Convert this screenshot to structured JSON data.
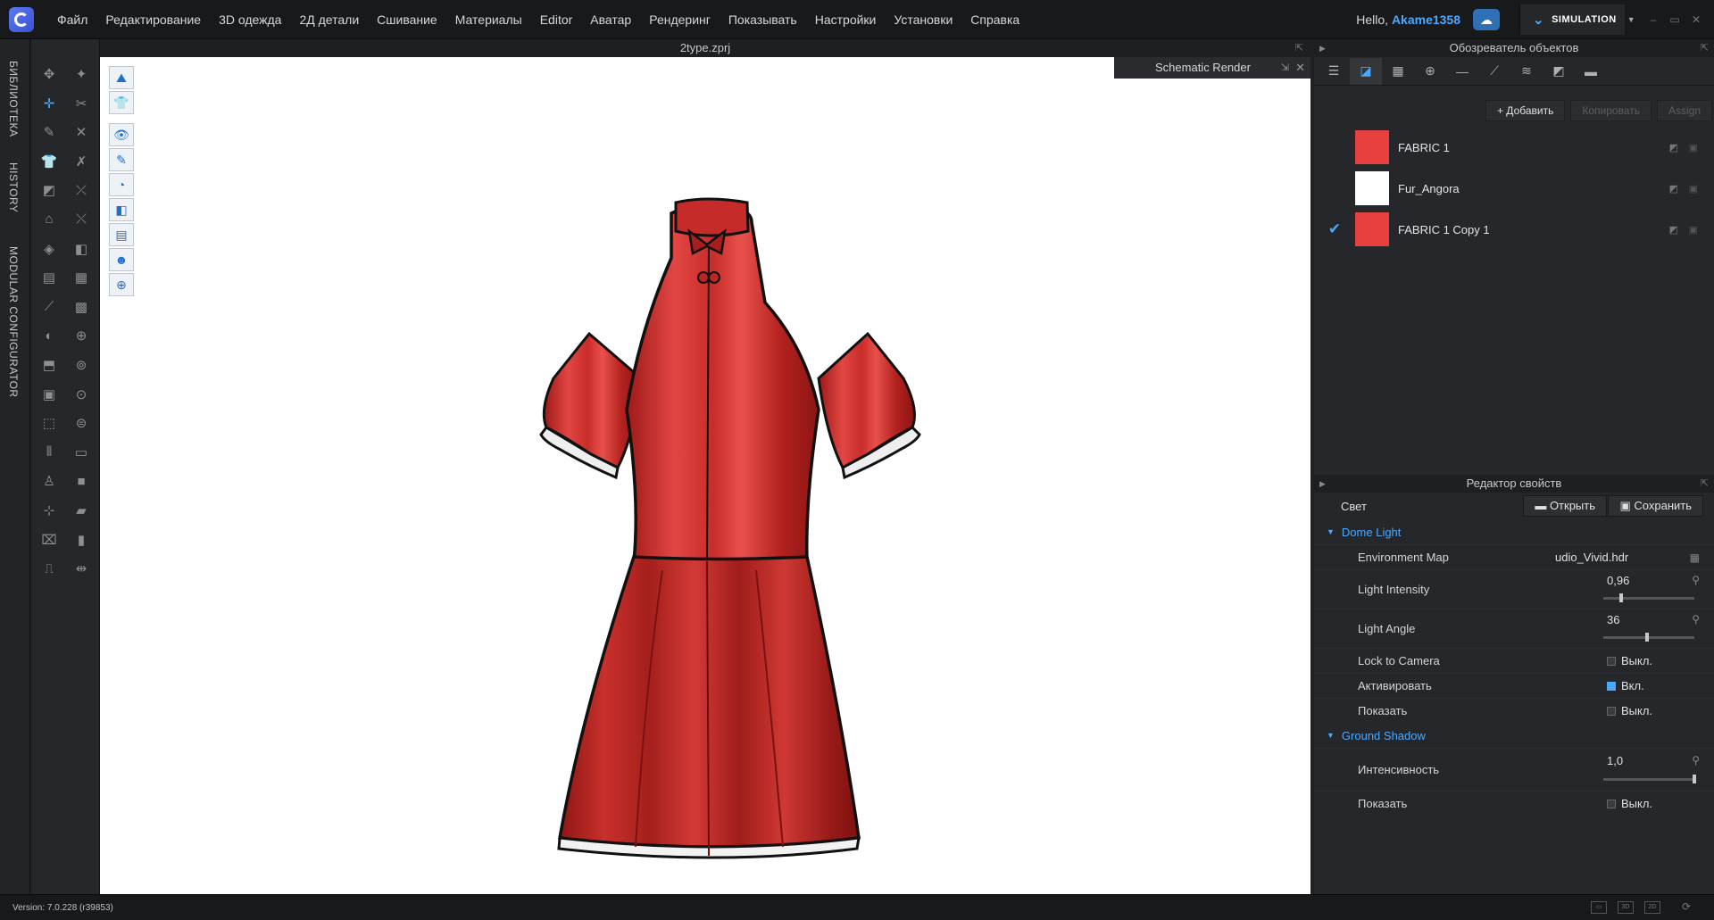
{
  "menubar": {
    "items": [
      "Файл",
      "Редактирование",
      "3D одежда",
      "2Д детали",
      "Сшивание",
      "Материалы",
      "Editor",
      "Аватар",
      "Рендеринг",
      "Показывать",
      "Настройки",
      "Установки",
      "Справка"
    ],
    "hello": "Hello, ",
    "username": "Akame1358",
    "mode": "SIMULATION"
  },
  "left_tabs": [
    "БИБЛИОТЕКА",
    "HISTORY",
    "MODULAR CONFIGURATOR"
  ],
  "viewport": {
    "file_title": "2type.zprj",
    "schematic_title": "Schematic Render"
  },
  "object_browser": {
    "title": "Обозреватель объектов",
    "add_label": "+ Добавить",
    "copy_label": "Копировать",
    "assign_label": "Assign",
    "materials": [
      {
        "name": "FABRIC 1",
        "color": "#e8403f",
        "checked": false
      },
      {
        "name": "Fur_Angora",
        "color": "#ffffff",
        "checked": true
      },
      {
        "name": "FABRIC 1 Copy 1",
        "color": "#e8403f",
        "checked": true
      }
    ]
  },
  "property_editor": {
    "title": "Редактор свойств",
    "section_label": "Свет",
    "open_label": "Открыть",
    "save_label": "Сохранить",
    "dome_light": {
      "title": "Dome Light",
      "env_map_label": "Environment Map",
      "env_map_value": "udio_Vivid.hdr",
      "intensity_label": "Light Intensity",
      "intensity_value": "0,96",
      "intensity_fraction": 0.2,
      "angle_label": "Light Angle",
      "angle_value": "36",
      "angle_fraction": 0.48,
      "lock_label": "Lock to Camera",
      "lock_value": "Выкл.",
      "activate_label": "Активировать",
      "activate_value": "Вкл.",
      "show_label": "Показать",
      "show_value": "Выкл."
    },
    "ground_shadow": {
      "title": "Ground Shadow",
      "intensity_label": "Интенсивность",
      "intensity_value": "1,0",
      "intensity_fraction": 1.0,
      "show_label": "Показать",
      "show_value": "Выкл."
    }
  },
  "status": {
    "version": "Version: 7.0.228 (r39853)"
  },
  "colors": {
    "accent": "#4aa8ff",
    "fabric": "#e8403f"
  }
}
